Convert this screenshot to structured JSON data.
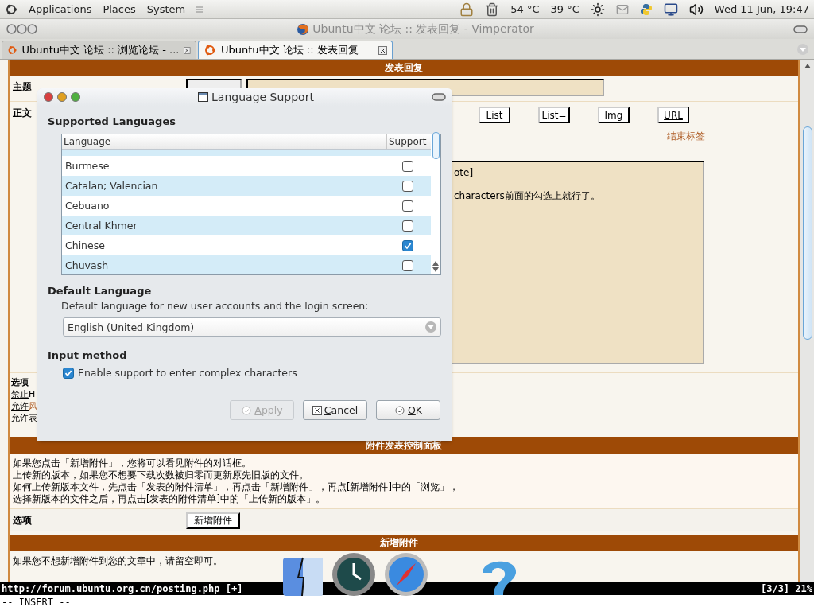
{
  "top_panel": {
    "menus": [
      "Applications",
      "Places",
      "System"
    ],
    "temperatures": [
      "54 °C",
      "39 °C"
    ],
    "clock": "Wed 11 Jun, 19:47"
  },
  "browser": {
    "title": "Ubuntu中文 论坛 :: 发表回复 - Vimperator",
    "tabs": [
      {
        "label": "Ubuntu中文 论坛 :: 浏览论坛 - ...",
        "selected": false
      },
      {
        "label": "Ubuntu中文 论坛 :: 发表回复",
        "selected": true
      }
    ]
  },
  "page": {
    "reply_header": "发表回复",
    "subject_label": "主题",
    "body_label": "正文",
    "format_buttons": [
      {
        "label": "List",
        "underlined": false
      },
      {
        "label": "List=",
        "underlined": false
      },
      {
        "label": "Img",
        "underlined": false
      },
      {
        "label": "URL",
        "underlined": true
      }
    ],
    "close_tags": "结束标签",
    "body_lines": [
      "ote]",
      "characters前面的勾选上就行了。"
    ],
    "options_label": "选项",
    "option_links": [
      {
        "link": "禁止",
        "rest": "H",
        "highlight": false
      },
      {
        "link": "允许",
        "rest": "风",
        "highlight": true
      },
      {
        "link": "允许",
        "rest": "表",
        "highlight": false
      }
    ],
    "attach_header": "附件发表控制面板",
    "attach_lines": [
      "如果您点击「新增附件」，您将可以看见附件的对话框。",
      "上传新的版本，如果您不想要下载次数被归零而更新原先旧版的文件。",
      "如何上传新版本文件，先点击「发表的附件清单」，再点击「新增附件」，再点[新增附件]中的「浏览」，",
      "选择新版本的文件之后，再点击[发表的附件清单]中的「上传新的版本」。"
    ],
    "attach_options_label": "选项",
    "add_attachment_button": "新增附件",
    "new_attach_header": "新增附件",
    "new_attach_note": "如果您不想新增附件到您的文章中，请留空即可。"
  },
  "dialog": {
    "title": "Language Support",
    "supported_heading": "Supported Languages",
    "columns": [
      "Language",
      "Support"
    ],
    "languages": [
      {
        "name": "Burmese",
        "checked": false
      },
      {
        "name": "Catalan; Valencian",
        "checked": false
      },
      {
        "name": "Cebuano",
        "checked": false
      },
      {
        "name": "Central Khmer",
        "checked": false
      },
      {
        "name": "Chinese",
        "checked": true
      },
      {
        "name": "Chuvash",
        "checked": false
      }
    ],
    "default_heading": "Default Language",
    "default_description": "Default language for new user accounts and the login screen:",
    "default_value": "English (United Kingdom)",
    "input_heading": "Input method",
    "complex_chars": {
      "label": "Enable support to enter complex characters",
      "checked": true
    },
    "buttons": [
      {
        "label": "Apply",
        "kind": "apply",
        "disabled": true
      },
      {
        "label": "Cancel",
        "kind": "cancel",
        "disabled": false
      },
      {
        "label": "OK",
        "kind": "ok",
        "disabled": false
      }
    ]
  },
  "status_bar": {
    "url": "http://forum.ubuntu.org.cn/posting.php [+]",
    "position": "[3/3] 21%"
  },
  "command_line": "-- INSERT --"
}
